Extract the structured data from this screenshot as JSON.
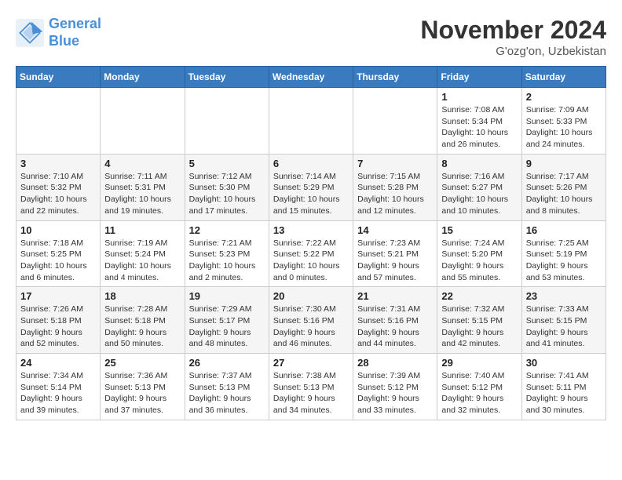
{
  "header": {
    "logo_line1": "General",
    "logo_line2": "Blue",
    "month": "November 2024",
    "location": "G'ozg'on, Uzbekistan"
  },
  "weekdays": [
    "Sunday",
    "Monday",
    "Tuesday",
    "Wednesday",
    "Thursday",
    "Friday",
    "Saturday"
  ],
  "weeks": [
    [
      {
        "day": "",
        "info": ""
      },
      {
        "day": "",
        "info": ""
      },
      {
        "day": "",
        "info": ""
      },
      {
        "day": "",
        "info": ""
      },
      {
        "day": "",
        "info": ""
      },
      {
        "day": "1",
        "info": "Sunrise: 7:08 AM\nSunset: 5:34 PM\nDaylight: 10 hours and 26 minutes."
      },
      {
        "day": "2",
        "info": "Sunrise: 7:09 AM\nSunset: 5:33 PM\nDaylight: 10 hours and 24 minutes."
      }
    ],
    [
      {
        "day": "3",
        "info": "Sunrise: 7:10 AM\nSunset: 5:32 PM\nDaylight: 10 hours and 22 minutes."
      },
      {
        "day": "4",
        "info": "Sunrise: 7:11 AM\nSunset: 5:31 PM\nDaylight: 10 hours and 19 minutes."
      },
      {
        "day": "5",
        "info": "Sunrise: 7:12 AM\nSunset: 5:30 PM\nDaylight: 10 hours and 17 minutes."
      },
      {
        "day": "6",
        "info": "Sunrise: 7:14 AM\nSunset: 5:29 PM\nDaylight: 10 hours and 15 minutes."
      },
      {
        "day": "7",
        "info": "Sunrise: 7:15 AM\nSunset: 5:28 PM\nDaylight: 10 hours and 12 minutes."
      },
      {
        "day": "8",
        "info": "Sunrise: 7:16 AM\nSunset: 5:27 PM\nDaylight: 10 hours and 10 minutes."
      },
      {
        "day": "9",
        "info": "Sunrise: 7:17 AM\nSunset: 5:26 PM\nDaylight: 10 hours and 8 minutes."
      }
    ],
    [
      {
        "day": "10",
        "info": "Sunrise: 7:18 AM\nSunset: 5:25 PM\nDaylight: 10 hours and 6 minutes."
      },
      {
        "day": "11",
        "info": "Sunrise: 7:19 AM\nSunset: 5:24 PM\nDaylight: 10 hours and 4 minutes."
      },
      {
        "day": "12",
        "info": "Sunrise: 7:21 AM\nSunset: 5:23 PM\nDaylight: 10 hours and 2 minutes."
      },
      {
        "day": "13",
        "info": "Sunrise: 7:22 AM\nSunset: 5:22 PM\nDaylight: 10 hours and 0 minutes."
      },
      {
        "day": "14",
        "info": "Sunrise: 7:23 AM\nSunset: 5:21 PM\nDaylight: 9 hours and 57 minutes."
      },
      {
        "day": "15",
        "info": "Sunrise: 7:24 AM\nSunset: 5:20 PM\nDaylight: 9 hours and 55 minutes."
      },
      {
        "day": "16",
        "info": "Sunrise: 7:25 AM\nSunset: 5:19 PM\nDaylight: 9 hours and 53 minutes."
      }
    ],
    [
      {
        "day": "17",
        "info": "Sunrise: 7:26 AM\nSunset: 5:18 PM\nDaylight: 9 hours and 52 minutes."
      },
      {
        "day": "18",
        "info": "Sunrise: 7:28 AM\nSunset: 5:18 PM\nDaylight: 9 hours and 50 minutes."
      },
      {
        "day": "19",
        "info": "Sunrise: 7:29 AM\nSunset: 5:17 PM\nDaylight: 9 hours and 48 minutes."
      },
      {
        "day": "20",
        "info": "Sunrise: 7:30 AM\nSunset: 5:16 PM\nDaylight: 9 hours and 46 minutes."
      },
      {
        "day": "21",
        "info": "Sunrise: 7:31 AM\nSunset: 5:16 PM\nDaylight: 9 hours and 44 minutes."
      },
      {
        "day": "22",
        "info": "Sunrise: 7:32 AM\nSunset: 5:15 PM\nDaylight: 9 hours and 42 minutes."
      },
      {
        "day": "23",
        "info": "Sunrise: 7:33 AM\nSunset: 5:15 PM\nDaylight: 9 hours and 41 minutes."
      }
    ],
    [
      {
        "day": "24",
        "info": "Sunrise: 7:34 AM\nSunset: 5:14 PM\nDaylight: 9 hours and 39 minutes."
      },
      {
        "day": "25",
        "info": "Sunrise: 7:36 AM\nSunset: 5:13 PM\nDaylight: 9 hours and 37 minutes."
      },
      {
        "day": "26",
        "info": "Sunrise: 7:37 AM\nSunset: 5:13 PM\nDaylight: 9 hours and 36 minutes."
      },
      {
        "day": "27",
        "info": "Sunrise: 7:38 AM\nSunset: 5:13 PM\nDaylight: 9 hours and 34 minutes."
      },
      {
        "day": "28",
        "info": "Sunrise: 7:39 AM\nSunset: 5:12 PM\nDaylight: 9 hours and 33 minutes."
      },
      {
        "day": "29",
        "info": "Sunrise: 7:40 AM\nSunset: 5:12 PM\nDaylight: 9 hours and 32 minutes."
      },
      {
        "day": "30",
        "info": "Sunrise: 7:41 AM\nSunset: 5:11 PM\nDaylight: 9 hours and 30 minutes."
      }
    ]
  ]
}
